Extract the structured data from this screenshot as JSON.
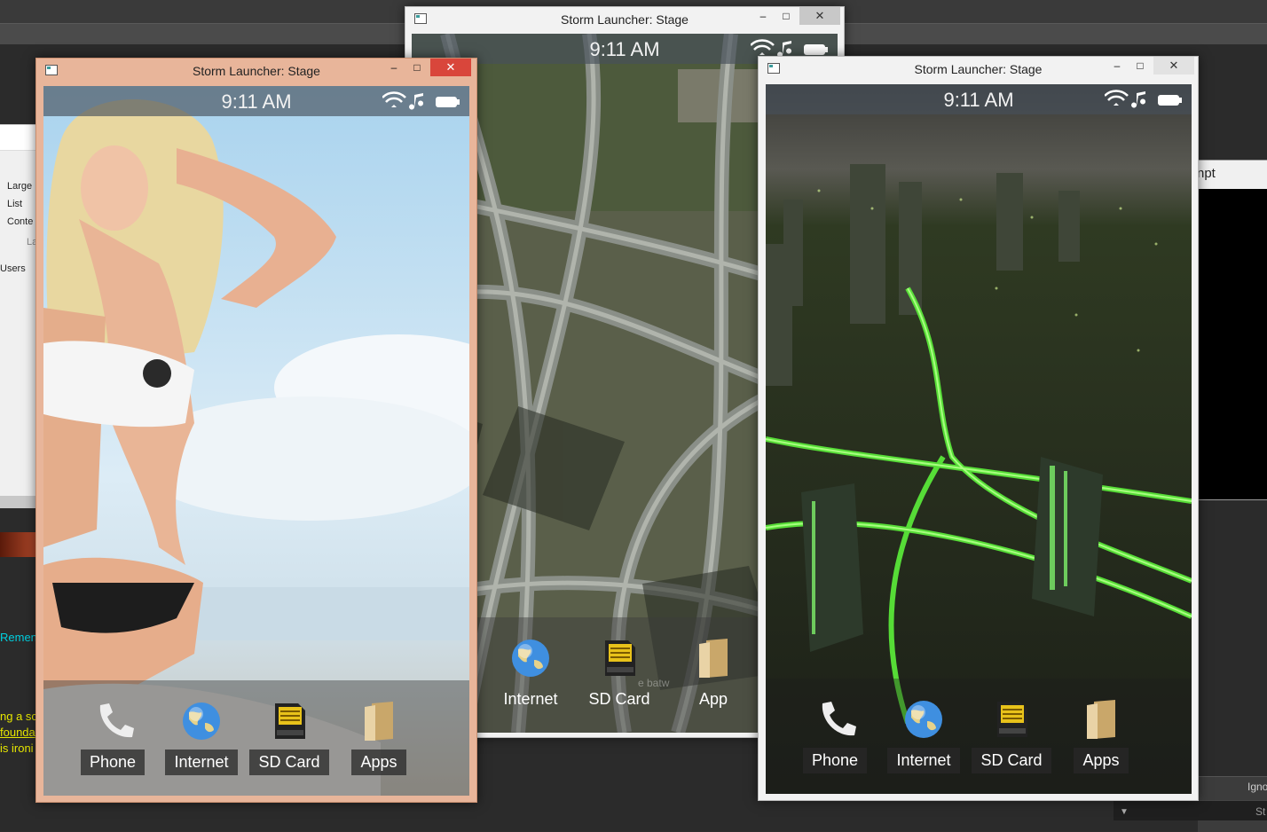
{
  "background": {
    "explorer_items": [
      "Large",
      "List",
      "Conte",
      "La",
      "Users"
    ],
    "console_lines": [
      "Remen",
      "ng a sc",
      "founda",
      "is ironi"
    ],
    "prompt_title": "npt",
    "right_label": "Igno",
    "bottom_label": "St"
  },
  "windows": [
    {
      "title": "Storm Launcher: Stage",
      "clock": "9:11 AM",
      "wallpaper": "beach-portrait",
      "dock": [
        "Phone",
        "Internet",
        "SD Card",
        "Apps"
      ]
    },
    {
      "title": "Storm Launcher: Stage",
      "clock": "9:11 AM",
      "wallpaper": "highway-interchange",
      "dock": [
        "one",
        "Internet",
        "SD Card",
        "App"
      ],
      "watermark": "e batw"
    },
    {
      "title": "Storm Launcher: Stage",
      "clock": "9:11 AM",
      "wallpaper": "night-city",
      "dock": [
        "Phone",
        "Internet",
        "SD Card",
        "Apps"
      ]
    }
  ],
  "controls": {
    "minimize": "–",
    "maximize": "□",
    "close": "✕"
  },
  "icons": [
    "wifi-icon",
    "music-icon",
    "battery-icon",
    "phone-icon",
    "globe-icon",
    "sd-card-icon",
    "apps-folder-icon"
  ],
  "colors": {
    "win1_frame": "#e8b59a",
    "win1_close": "#d9463b",
    "win_frame": "#f2f2f2"
  }
}
